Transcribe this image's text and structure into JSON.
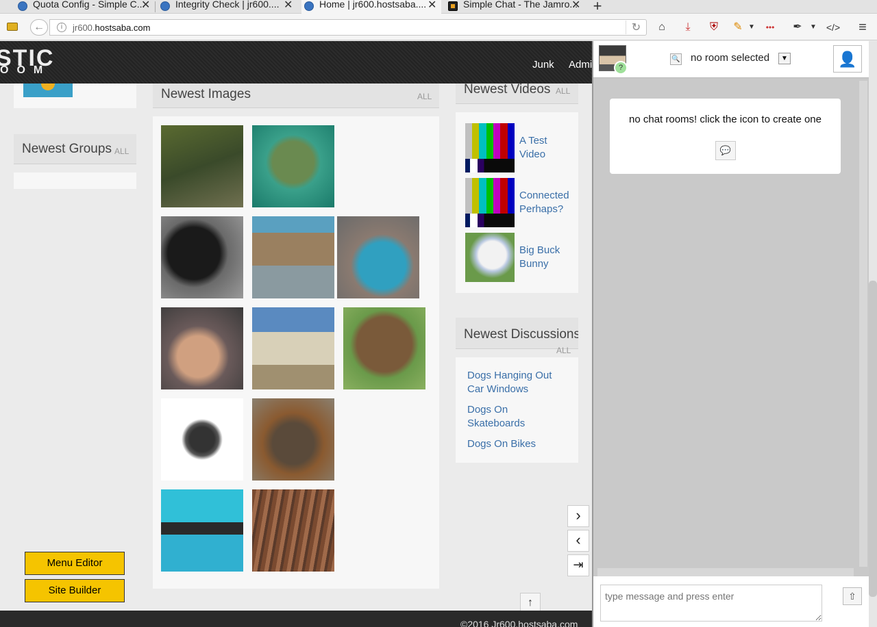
{
  "browser": {
    "tabs": [
      {
        "label": "Quota Config - Simple C..."
      },
      {
        "label": "Integrity Check | jr600...."
      },
      {
        "label": "Home | jr600.hostsaba...."
      },
      {
        "label": "Simple Chat - The Jamro..."
      }
    ],
    "url_prefix": "jr600.",
    "url_domain": "hostsaba.com"
  },
  "site": {
    "logo_top": "STIC",
    "logo_bottom": "OOM",
    "nav": [
      "Junk",
      "Admi"
    ],
    "newest_groups": {
      "title": "Newest Groups",
      "all": "ALL"
    },
    "newest_images": {
      "title": "Newest Images",
      "all": "ALL"
    },
    "newest_videos": {
      "title": "Newest Videos",
      "all": "ALL",
      "items": [
        {
          "line1": "A Test",
          "line2": "Video"
        },
        {
          "line1": "Connected",
          "line2": "Perhaps?"
        },
        {
          "line1": "Big Buck",
          "line2": "Bunny"
        }
      ]
    },
    "newest_discussions": {
      "title": "Newest Discussions",
      "all": "ALL",
      "items": [
        {
          "line1": "Dogs Hanging Out",
          "line2": "Car Windows"
        },
        {
          "line1": "Dogs On",
          "line2": "Skateboards"
        },
        {
          "line1": "Dogs On Bikes",
          "line2": ""
        }
      ]
    },
    "buttons": {
      "menu_editor": "Menu Editor",
      "site_builder": "Site Builder"
    },
    "copyright": "©2016 Jr600.hostsaba.com"
  },
  "chat": {
    "room_label": "no room selected",
    "empty_message": "no chat rooms! click the icon to create one",
    "input_placeholder": "type message and press enter",
    "status_badge": "?"
  },
  "colors": {
    "button_yellow": "#f5c400",
    "link_blue": "#3a6fa8",
    "header_dark": "#262626"
  }
}
